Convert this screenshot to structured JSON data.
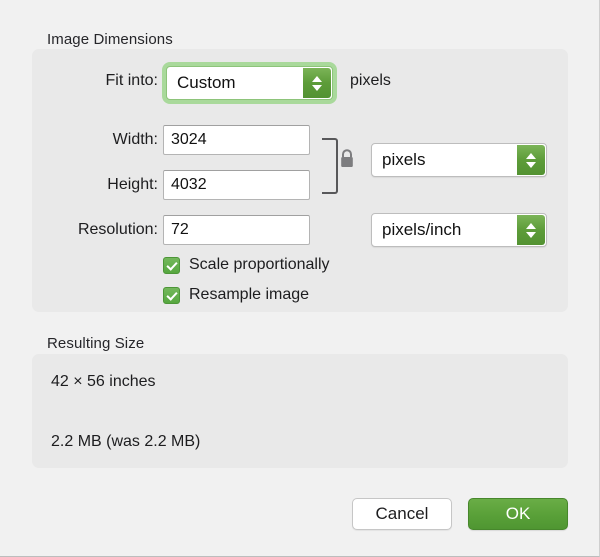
{
  "dialog": {
    "sections": {
      "image_dimensions": {
        "label": "Image Dimensions",
        "fit_into": {
          "label": "Fit into:",
          "value": "Custom",
          "suffix": "pixels",
          "focused": true
        },
        "width": {
          "label": "Width:",
          "value": "3024"
        },
        "height": {
          "label": "Height:",
          "value": "4032"
        },
        "size_units": {
          "value": "pixels"
        },
        "resolution": {
          "label": "Resolution:",
          "value": "72"
        },
        "resolution_units": {
          "value": "pixels/inch"
        },
        "link_lock": {
          "icon": "lock-closed-icon",
          "state": "locked"
        },
        "checkboxes": [
          {
            "label": "Scale proportionally",
            "checked": true
          },
          {
            "label": "Resample image",
            "checked": true
          }
        ]
      },
      "resulting_size": {
        "label": "Resulting Size",
        "dimensions": "42 × 56 inches",
        "filesize": "2.2 MB (was 2.2 MB)"
      }
    },
    "footer": {
      "cancel_label": "Cancel",
      "ok_label": "OK"
    },
    "colors": {
      "accent_green": "#59a038",
      "focus_ring_green": "#a9d99b",
      "checkbox_green": "#56a73f",
      "window_background": "#f1f1f1",
      "group_background": "#e9e9e9"
    },
    "icons": {
      "stepper": "stepper-up-down-icon",
      "checkmark": "checkmark-icon"
    }
  }
}
